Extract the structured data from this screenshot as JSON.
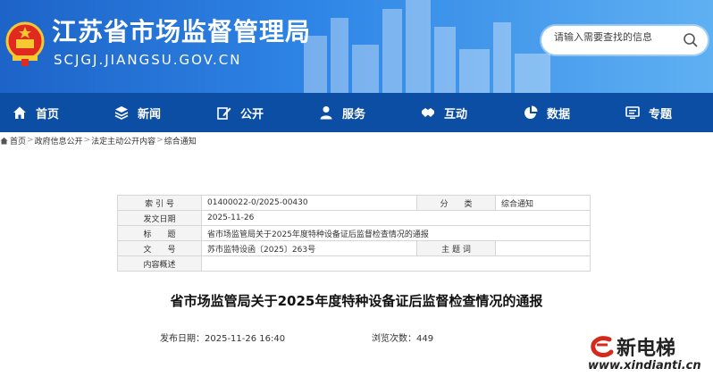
{
  "header": {
    "site_title": "江苏省市场监督管理局",
    "domain": "SCJGJ.JIANGSU.GOV.CN",
    "search_placeholder": "请输入需要查找的信息"
  },
  "nav": {
    "items": [
      {
        "label": "首页",
        "icon": "home-icon"
      },
      {
        "label": "新闻",
        "icon": "layers-icon"
      },
      {
        "label": "公开",
        "icon": "edit-icon"
      },
      {
        "label": "服务",
        "icon": "person-icon"
      },
      {
        "label": "互动",
        "icon": "handshake-icon"
      },
      {
        "label": "数据",
        "icon": "pie-chart-icon"
      },
      {
        "label": "专题",
        "icon": "monitor-icon"
      }
    ]
  },
  "breadcrumb": [
    "首页",
    "政府信息公开",
    "法定主动公开内容",
    "综合通知"
  ],
  "meta": {
    "index_label": "索 引 号",
    "index_value": "01400022-0/2025-00430",
    "category_label": "分　　类",
    "category_value": "综合通知",
    "date_label": "发文日期",
    "date_value": "2025-11-26",
    "title_label": "标　　题",
    "title_value": "省市场监管局关于2025年度特种设备证后监督检查情况的通报",
    "docno_label": "文　　号",
    "docno_value": "苏市监特设函〔2025〕263号",
    "subject_label": "主 题 词",
    "subject_value": "",
    "summary_label": "内容概述",
    "summary_value": ""
  },
  "article": {
    "title": "省市场监管局关于2025年度特种设备证后监督检查情况的通报",
    "publish_label": "发布日期：",
    "publish_value": "2025-11-26 16:40",
    "views_label": "浏览次数：",
    "views_value": "449"
  },
  "watermark": {
    "text": "新电梯",
    "url": "www.xindianti.cn"
  },
  "colors": {
    "header_start": "#1d63c8",
    "header_end": "#5fb0f2",
    "nav_bg": "#0b4ea4"
  }
}
